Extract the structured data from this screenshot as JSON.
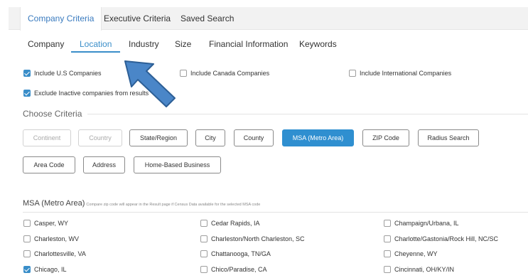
{
  "top_tabs": [
    "Company Criteria",
    "Executive Criteria",
    "Saved Search"
  ],
  "sub_tabs": [
    "Company",
    "Location",
    "Industry",
    "Size",
    "Financial Information",
    "Keywords"
  ],
  "include_options": [
    {
      "label": "Include U.S Companies",
      "checked": true
    },
    {
      "label": "Include Canada Companies",
      "checked": false
    },
    {
      "label": "Include International Companies",
      "checked": false
    }
  ],
  "exclude_inactive": {
    "label": "Exclude Inactive companies from results",
    "checked": true
  },
  "choose_criteria_title": "Choose Criteria",
  "criteria_buttons": [
    {
      "label": "Continent",
      "state": "disabled"
    },
    {
      "label": "Country",
      "state": "disabled"
    },
    {
      "label": "State/Region",
      "state": "normal"
    },
    {
      "label": "City",
      "state": "normal"
    },
    {
      "label": "County",
      "state": "normal"
    },
    {
      "label": "MSA (Metro Area)",
      "state": "active"
    },
    {
      "label": "ZIP Code",
      "state": "normal"
    },
    {
      "label": "Radius Search",
      "state": "normal"
    },
    {
      "label": "Area Code",
      "state": "normal"
    },
    {
      "label": "Address",
      "state": "normal"
    },
    {
      "label": "Home-Based Business",
      "state": "normal"
    }
  ],
  "msa": {
    "title": "MSA (Metro Area)",
    "note": "Compare zip code will appear in the Result page if Census Data available for the selected MSA code",
    "items": [
      {
        "label": "Casper, WY",
        "checked": false
      },
      {
        "label": "Cedar Rapids, IA",
        "checked": false
      },
      {
        "label": "Champaign/Urbana, IL",
        "checked": false
      },
      {
        "label": "Charleston, WV",
        "checked": false
      },
      {
        "label": "Charleston/North Charleston, SC",
        "checked": false
      },
      {
        "label": "Charlotte/Gastonia/Rock Hill, NC/SC",
        "checked": false
      },
      {
        "label": "Charlottesville, VA",
        "checked": false
      },
      {
        "label": "Chattanooga, TN/GA",
        "checked": false
      },
      {
        "label": "Cheyenne, WY",
        "checked": false
      },
      {
        "label": "Chicago, IL",
        "checked": true
      },
      {
        "label": "Chico/Paradise, CA",
        "checked": false
      },
      {
        "label": "Cincinnati, OH/KY/IN",
        "checked": false
      }
    ]
  },
  "colors": {
    "accent": "#3a8ec9",
    "active_button": "#2f8fd0",
    "arrow_fill": "#4a86c8",
    "arrow_stroke": "#2d5f96"
  }
}
